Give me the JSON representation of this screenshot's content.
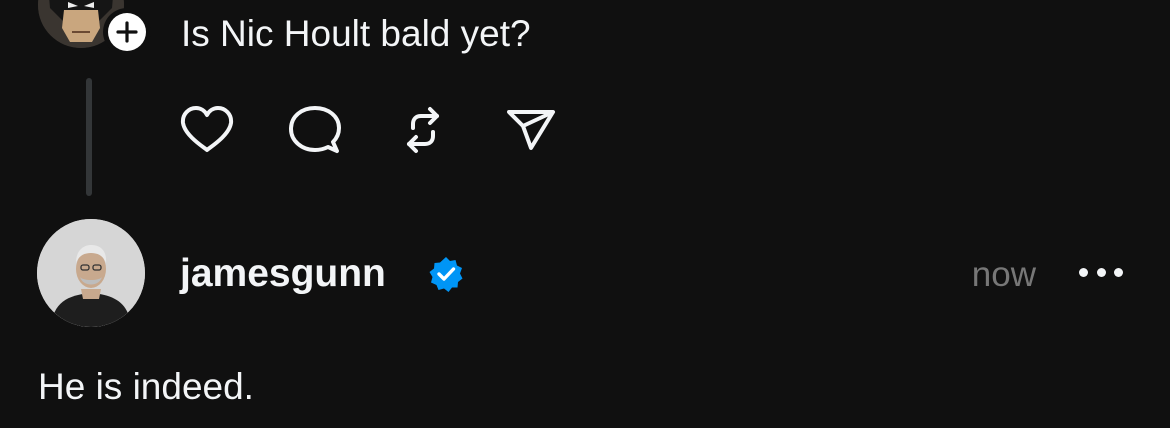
{
  "reply_post": {
    "text": "Is Nic Hoult bald yet?",
    "avatar_icon": "batman-avatar-icon",
    "follow_icon": "plus-icon",
    "actions": [
      {
        "icon": "heart-icon"
      },
      {
        "icon": "comment-icon"
      },
      {
        "icon": "repost-icon"
      },
      {
        "icon": "share-icon"
      }
    ]
  },
  "response_post": {
    "username": "jamesgunn",
    "verified_icon": "verified-badge-icon",
    "timestamp": "now",
    "more_icon": "more-options-icon",
    "text": "He is indeed."
  },
  "colors": {
    "background": "#101010",
    "text": "#f3f5f7",
    "muted": "#777777",
    "thread_line": "#333638",
    "verified": "#0095f6"
  }
}
